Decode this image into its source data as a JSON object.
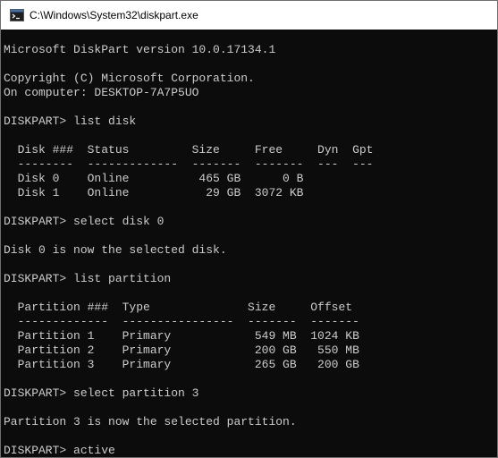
{
  "window": {
    "title": "C:\\Windows\\System32\\diskpart.exe",
    "icon": "console-app-icon"
  },
  "console": {
    "lines": [
      "Microsoft DiskPart version 10.0.17134.1",
      "",
      "Copyright (C) Microsoft Corporation.",
      "On computer: DESKTOP-7A7P5UO",
      "",
      "DISKPART> list disk",
      "",
      "  Disk ###  Status         Size     Free     Dyn  Gpt",
      "  --------  -------------  -------  -------  ---  ---",
      "  Disk 0    Online          465 GB      0 B",
      "  Disk 1    Online           29 GB  3072 KB",
      "",
      "DISKPART> select disk 0",
      "",
      "Disk 0 is now the selected disk.",
      "",
      "DISKPART> list partition",
      "",
      "  Partition ###  Type              Size     Offset",
      "  -------------  ----------------  -------  -------",
      "  Partition 1    Primary            549 MB  1024 KB",
      "  Partition 2    Primary            200 GB   550 MB",
      "  Partition 3    Primary            265 GB   200 GB",
      "",
      "DISKPART> select partition 3",
      "",
      "Partition 3 is now the selected partition.",
      "",
      "DISKPART> active"
    ]
  },
  "colors": {
    "console_background": "#0c0c0c",
    "console_text": "#cccccc",
    "titlebar_background": "#ffffff"
  }
}
